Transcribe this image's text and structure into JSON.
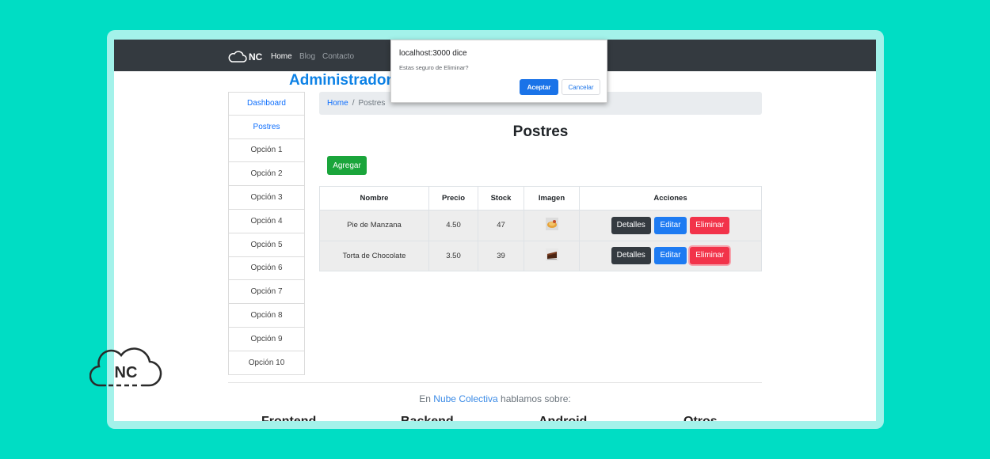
{
  "brand": {
    "logo_text": "NC"
  },
  "navbar": {
    "links": [
      "Home",
      "Blog",
      "Contacto"
    ],
    "active_link": "Home"
  },
  "admin_title": "Administrador",
  "sidebar": {
    "items": [
      {
        "label": "Dashboard",
        "link": true
      },
      {
        "label": "Postres",
        "link": true
      },
      {
        "label": "Opción 1",
        "link": false
      },
      {
        "label": "Opción 2",
        "link": false
      },
      {
        "label": "Opción 3",
        "link": false
      },
      {
        "label": "Opción 4",
        "link": false
      },
      {
        "label": "Opción 5",
        "link": false
      },
      {
        "label": "Opción 6",
        "link": false
      },
      {
        "label": "Opción 7",
        "link": false
      },
      {
        "label": "Opción 8",
        "link": false
      },
      {
        "label": "Opción 9",
        "link": false
      },
      {
        "label": "Opción 10",
        "link": false
      }
    ]
  },
  "breadcrumb": {
    "home": "Home",
    "separator": "/",
    "current": "Postres"
  },
  "page_heading": "Postres",
  "add_button": "Agregar",
  "table": {
    "headers": [
      "Nombre",
      "Precio",
      "Stock",
      "Imagen",
      "Acciones"
    ],
    "rows": [
      {
        "nombre": "Pie de Manzana",
        "precio": "4.50",
        "stock": "47",
        "image_icon": "apple-pie-thumbnail"
      },
      {
        "nombre": "Torta de Chocolate",
        "precio": "3.50",
        "stock": "39",
        "image_icon": "chocolate-cake-thumbnail"
      }
    ],
    "actions": {
      "details": "Detalles",
      "edit": "Editar",
      "delete": "Eliminar"
    }
  },
  "dialog": {
    "title": "localhost:3000 dice",
    "message": "Estas seguro de Eliminar?",
    "ok": "Aceptar",
    "cancel": "Cancelar"
  },
  "footer": {
    "prefix": "En",
    "link": "Nube Colectiva",
    "suffix": "hablamos sobre:",
    "categories": [
      "Frontend",
      "Backend",
      "Android",
      "Otros"
    ]
  },
  "watermark": {
    "text": "NC"
  },
  "colors": {
    "page_background": "#00ddc4",
    "navbar": "#343a40",
    "primary": "#0d6efd",
    "success": "#1aa53b",
    "danger": "#f2334a",
    "dark": "#343a40"
  }
}
